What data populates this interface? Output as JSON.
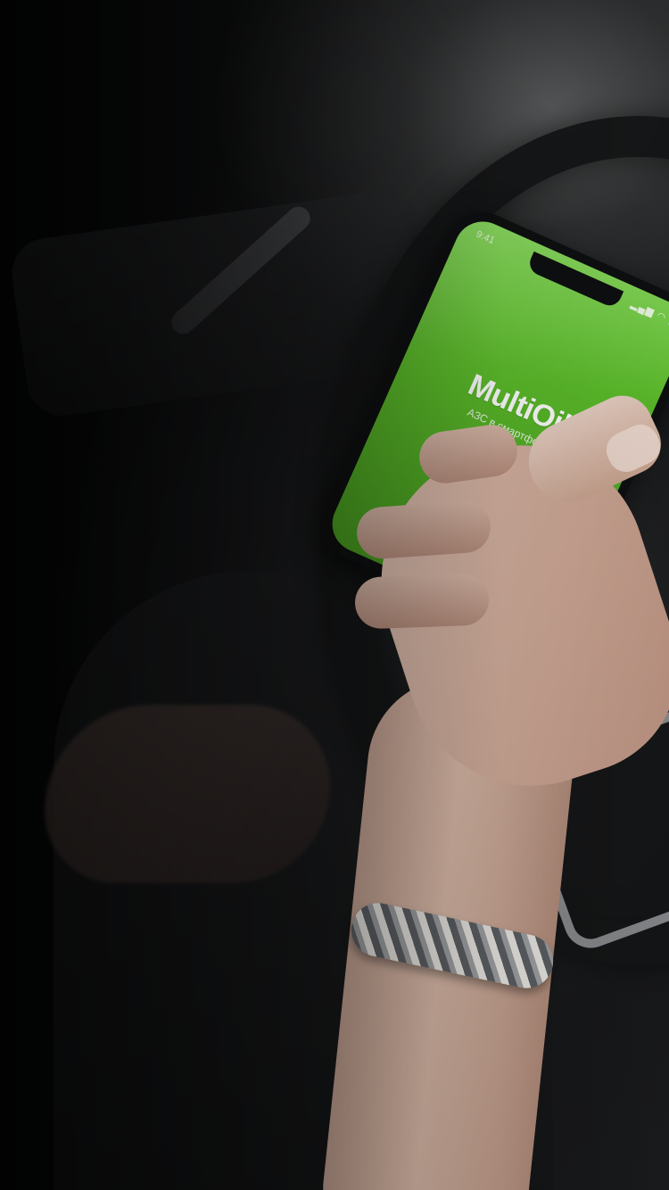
{
  "phone": {
    "status_time": "9:41",
    "status_icons": "▂▄▆ ◠ ▮",
    "app_title": "MultiOil",
    "app_subtitle": "АЗС в смартфоне"
  },
  "colors": {
    "brand_green": "#5cbd2a",
    "background_dark": "#0b0c0d"
  }
}
